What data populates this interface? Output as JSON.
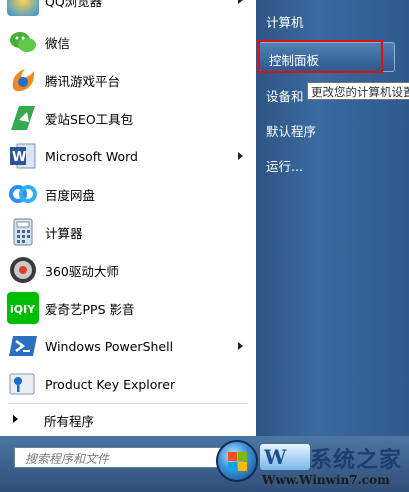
{
  "programs": [
    {
      "label": "QQ浏览器",
      "icon": "qq-browser-icon",
      "submenu": true
    },
    {
      "label": "微信",
      "icon": "wechat-icon",
      "submenu": false
    },
    {
      "label": "腾讯游戏平台",
      "icon": "tencent-game-icon",
      "submenu": false
    },
    {
      "label": "爱站SEO工具包",
      "icon": "aizhan-seo-icon",
      "submenu": false
    },
    {
      "label": "Microsoft Word",
      "icon": "word-icon",
      "submenu": true
    },
    {
      "label": "百度网盘",
      "icon": "baidu-netdisk-icon",
      "submenu": false
    },
    {
      "label": "计算器",
      "icon": "calculator-icon",
      "submenu": false
    },
    {
      "label": "360驱动大师",
      "icon": "driver-master-icon",
      "submenu": false
    },
    {
      "label": "爱奇艺PPS 影音",
      "icon": "iqiyi-icon",
      "submenu": false
    },
    {
      "label": "Windows PowerShell",
      "icon": "powershell-icon",
      "submenu": true
    },
    {
      "label": "Product Key Explorer",
      "icon": "key-icon",
      "submenu": false
    }
  ],
  "all_programs": "所有程序",
  "search": {
    "placeholder": "搜索程序和文件"
  },
  "right_items": [
    "计算机",
    "控制面板",
    "设备和",
    "默认程序",
    "运行..."
  ],
  "tooltip": "更改您的计算机设置",
  "watermark": {
    "top": "系统之家",
    "bottom": "Www.Winwin7.com",
    "logo_text": "W"
  },
  "colors": {
    "right_panel": "#2e5a8d",
    "highlight_border": "#e01010"
  }
}
